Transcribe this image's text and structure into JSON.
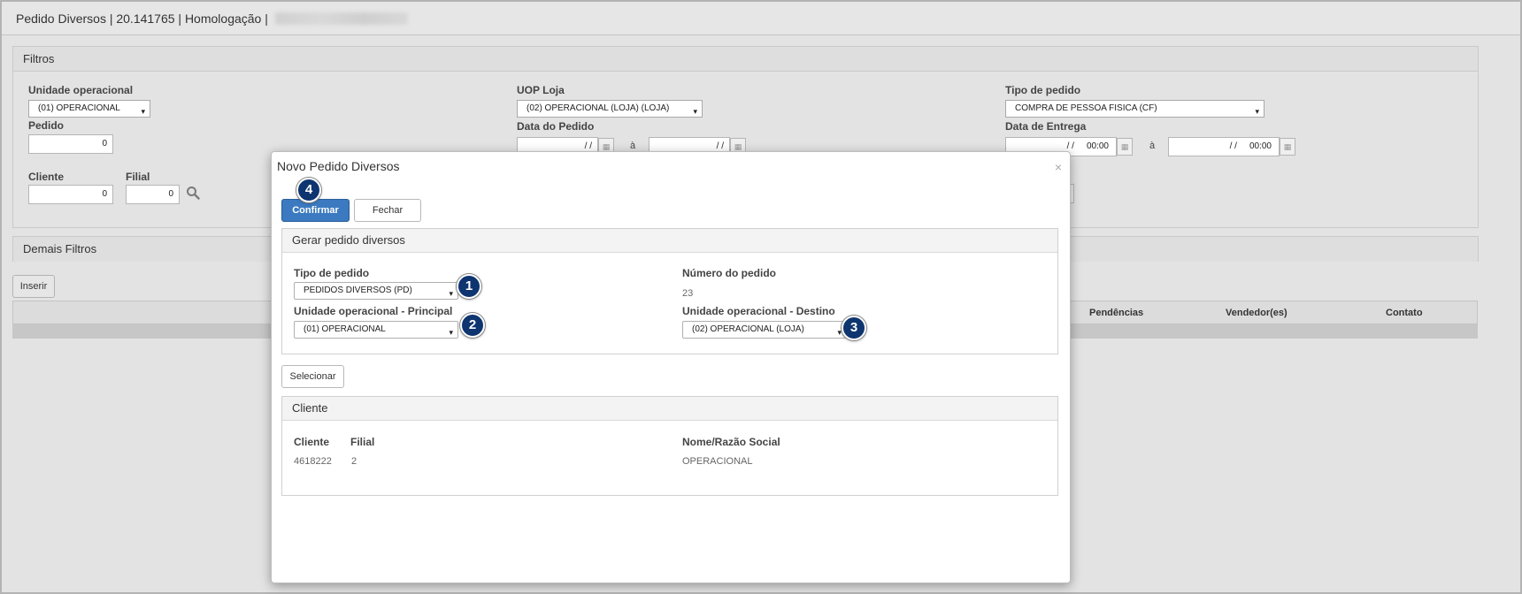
{
  "header": {
    "title": "Pedido Diversos | 20.141765 | Homologação |"
  },
  "filters": {
    "title": "Filtros",
    "unidade_label": "Unidade operacional",
    "unidade_value": "(01) OPERACIONAL",
    "uop_label": "UOP Loja",
    "uop_value": "(02) OPERACIONAL (LOJA) (LOJA)",
    "tipo_label": "Tipo de pedido",
    "tipo_value": "COMPRA DE PESSOA FISICA (CF)",
    "pedido_label": "Pedido",
    "pedido_value": "0",
    "data_pedido_label": "Data do Pedido",
    "date_placeholder": "/ /",
    "a_label": "à",
    "data_entrega_label": "Data de Entrega",
    "time_value": "00:00",
    "cliente_label": "Cliente",
    "cliente_value": "0",
    "filial_label": "Filial",
    "filial_value": "0"
  },
  "demais": {
    "title": "Demais Filtros"
  },
  "actions": {
    "inserir_label": "Inserir"
  },
  "grid": {
    "columns": [
      "Pendências",
      "Vendedor(es)",
      "Contato"
    ]
  },
  "modal": {
    "title": "Novo Pedido Diversos",
    "close_glyph": "×",
    "confirm_label": "Confirmar",
    "close_label": "Fechar",
    "gerar": {
      "title": "Gerar pedido diversos",
      "tipo_label": "Tipo de pedido",
      "tipo_value": "PEDIDOS DIVERSOS (PD)",
      "numero_label": "Número do pedido",
      "numero_value": "23",
      "principal_label": "Unidade operacional - Principal",
      "principal_value": "(01) OPERACIONAL",
      "destino_label": "Unidade operacional - Destino",
      "destino_value": "(02) OPERACIONAL (LOJA)"
    },
    "selecionar_label": "Selecionar",
    "cliente_panel": {
      "title": "Cliente",
      "cliente_label": "Cliente",
      "cliente_value": "4618222",
      "filial_label": "Filial",
      "filial_value": "2",
      "nome_label": "Nome/Razão Social",
      "nome_value": "OPERACIONAL"
    }
  },
  "badges": [
    "1",
    "2",
    "3",
    "4"
  ],
  "icons": {
    "chevron": "▾",
    "calendar": "▦",
    "search": "search-icon"
  },
  "colors": {
    "primary_button": "#3b7ac0",
    "badge": "#0e3570"
  }
}
